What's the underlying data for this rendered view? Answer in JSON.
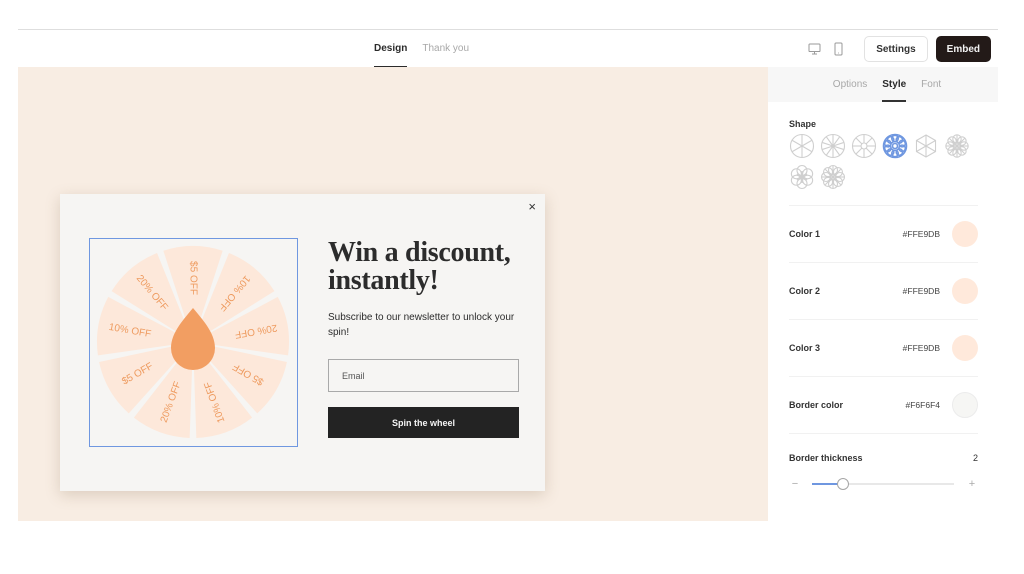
{
  "header": {
    "tabs": [
      {
        "label": "Design",
        "active": true
      },
      {
        "label": "Thank you",
        "active": false
      }
    ],
    "icons": [
      "desktop-icon",
      "mobile-icon"
    ],
    "settings_label": "Settings",
    "embed_label": "Embed"
  },
  "popup": {
    "close_symbol": "×",
    "headline_line1": "Win a discount,",
    "headline_line2": "instantly!",
    "subtext": "Subscribe to our newsletter to unlock your spin!",
    "email_placeholder": "Email",
    "email_value": "",
    "button_label": "Spin the wheel",
    "wheel": {
      "segments": [
        "$5 OFF",
        "10% OFF",
        "20% OFF",
        "$5 OFF",
        "10% OFF",
        "20% OFF",
        "$5 OFF",
        "10% OFF",
        "20% OFF",
        "$5 OFF"
      ],
      "segment_labels_clockwise_from_top": [
        "$5 OFF",
        "10% OFF",
        "20% OFF",
        "$5 OFF",
        "10% OFF",
        "20% OFF",
        "$5 OFF",
        "10% OFF",
        "20% OFF"
      ],
      "segment_color": "#FDE8DA",
      "text_color": "#EE9A5E",
      "pointer_color": "#F29E62",
      "selection_color": "#6F97E0"
    }
  },
  "sidebar": {
    "tabs": [
      {
        "label": "Options",
        "active": false
      },
      {
        "label": "Style",
        "active": true
      },
      {
        "label": "Font",
        "active": false
      }
    ],
    "shape_label": "Shape",
    "shapes": [
      {
        "name": "wheel-6-spokes",
        "selected": false
      },
      {
        "name": "wheel-10-spokes",
        "selected": false
      },
      {
        "name": "wheel-hub",
        "selected": false
      },
      {
        "name": "flower-10-petals",
        "selected": true
      },
      {
        "name": "hexagon-petals",
        "selected": false
      },
      {
        "name": "star-petals",
        "selected": false
      },
      {
        "name": "flower-6-petals",
        "selected": false
      },
      {
        "name": "flower-8-petals",
        "selected": false
      }
    ],
    "colors": [
      {
        "label": "Color 1",
        "hex": "#FFE9DB"
      },
      {
        "label": "Color 2",
        "hex": "#FFE9DB"
      },
      {
        "label": "Color 3",
        "hex": "#FFE9DB"
      },
      {
        "label": "Border color",
        "hex": "#F6F6F4"
      }
    ],
    "border_thickness": {
      "label": "Border thickness",
      "value": "2",
      "slider_fraction": 0.22,
      "minus": "−",
      "plus": "+"
    }
  },
  "theme": {
    "canvas_bg": "#F8EDE3",
    "accent": "#6F97E0",
    "embed_bg": "#231A18"
  }
}
